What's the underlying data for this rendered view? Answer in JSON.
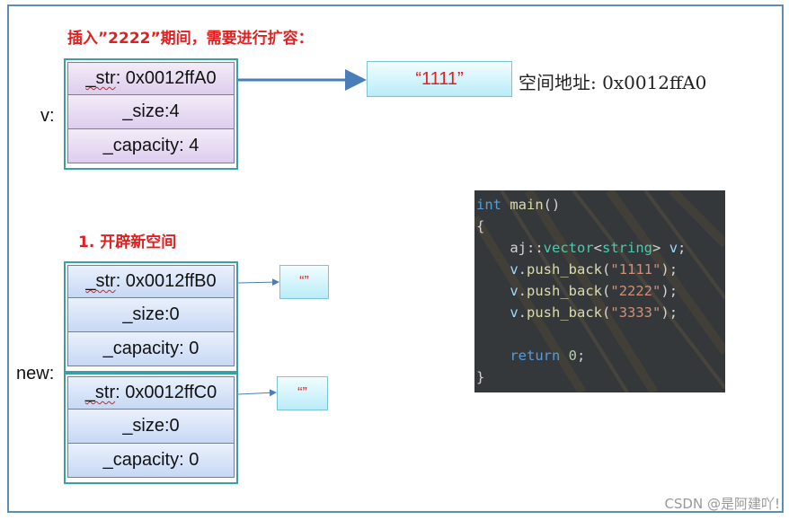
{
  "title_top": "插入”2222”期间，需要进行扩容：",
  "title_step1": "1. 开辟新空间",
  "v_struct": {
    "label": "v:",
    "str_name": "_str",
    "str_value": ": 0x0012ffA0",
    "size": "_size:4",
    "capacity": "_capacity: 4"
  },
  "v_string": "“1111”",
  "v_address": "空间地址: 0x0012ffA0",
  "new_label": "new:",
  "new_struct_1": {
    "str_name": "_str",
    "str_value": ": 0x0012ffB0",
    "size": "_size:0",
    "capacity": "_capacity: 0",
    "string": "“”"
  },
  "new_struct_2": {
    "str_name": "_str",
    "str_value": ": 0x0012ffC0",
    "size": "_size:0",
    "capacity": "_capacity: 0",
    "string": "“”"
  },
  "code": {
    "l1_kw": "int",
    "l1_fn": "main",
    "l1_p": "()",
    "l2": "{",
    "l3_ns": "aj",
    "l3_sep": "::",
    "l3_ty": "vector",
    "l3_lt": "<",
    "l3_ty2": "string",
    "l3_gt": ">",
    "l3_var": "v",
    "l3_end": ";",
    "push_obj": "v",
    "push_dot": ".",
    "push_fn": "push_back",
    "s1": "\"1111\"",
    "s2": "\"2222\"",
    "s3": "\"3333\"",
    "l8_kw": "return",
    "l8_num": "0",
    "l8_end": ";",
    "l9": "}"
  },
  "watermark": "CSDN @是阿建吖!",
  "colors": {
    "title": "#e02020",
    "frame": "#5b8db8",
    "struct_border": "#3aa0a8",
    "arrow": "#4a7ebb"
  }
}
